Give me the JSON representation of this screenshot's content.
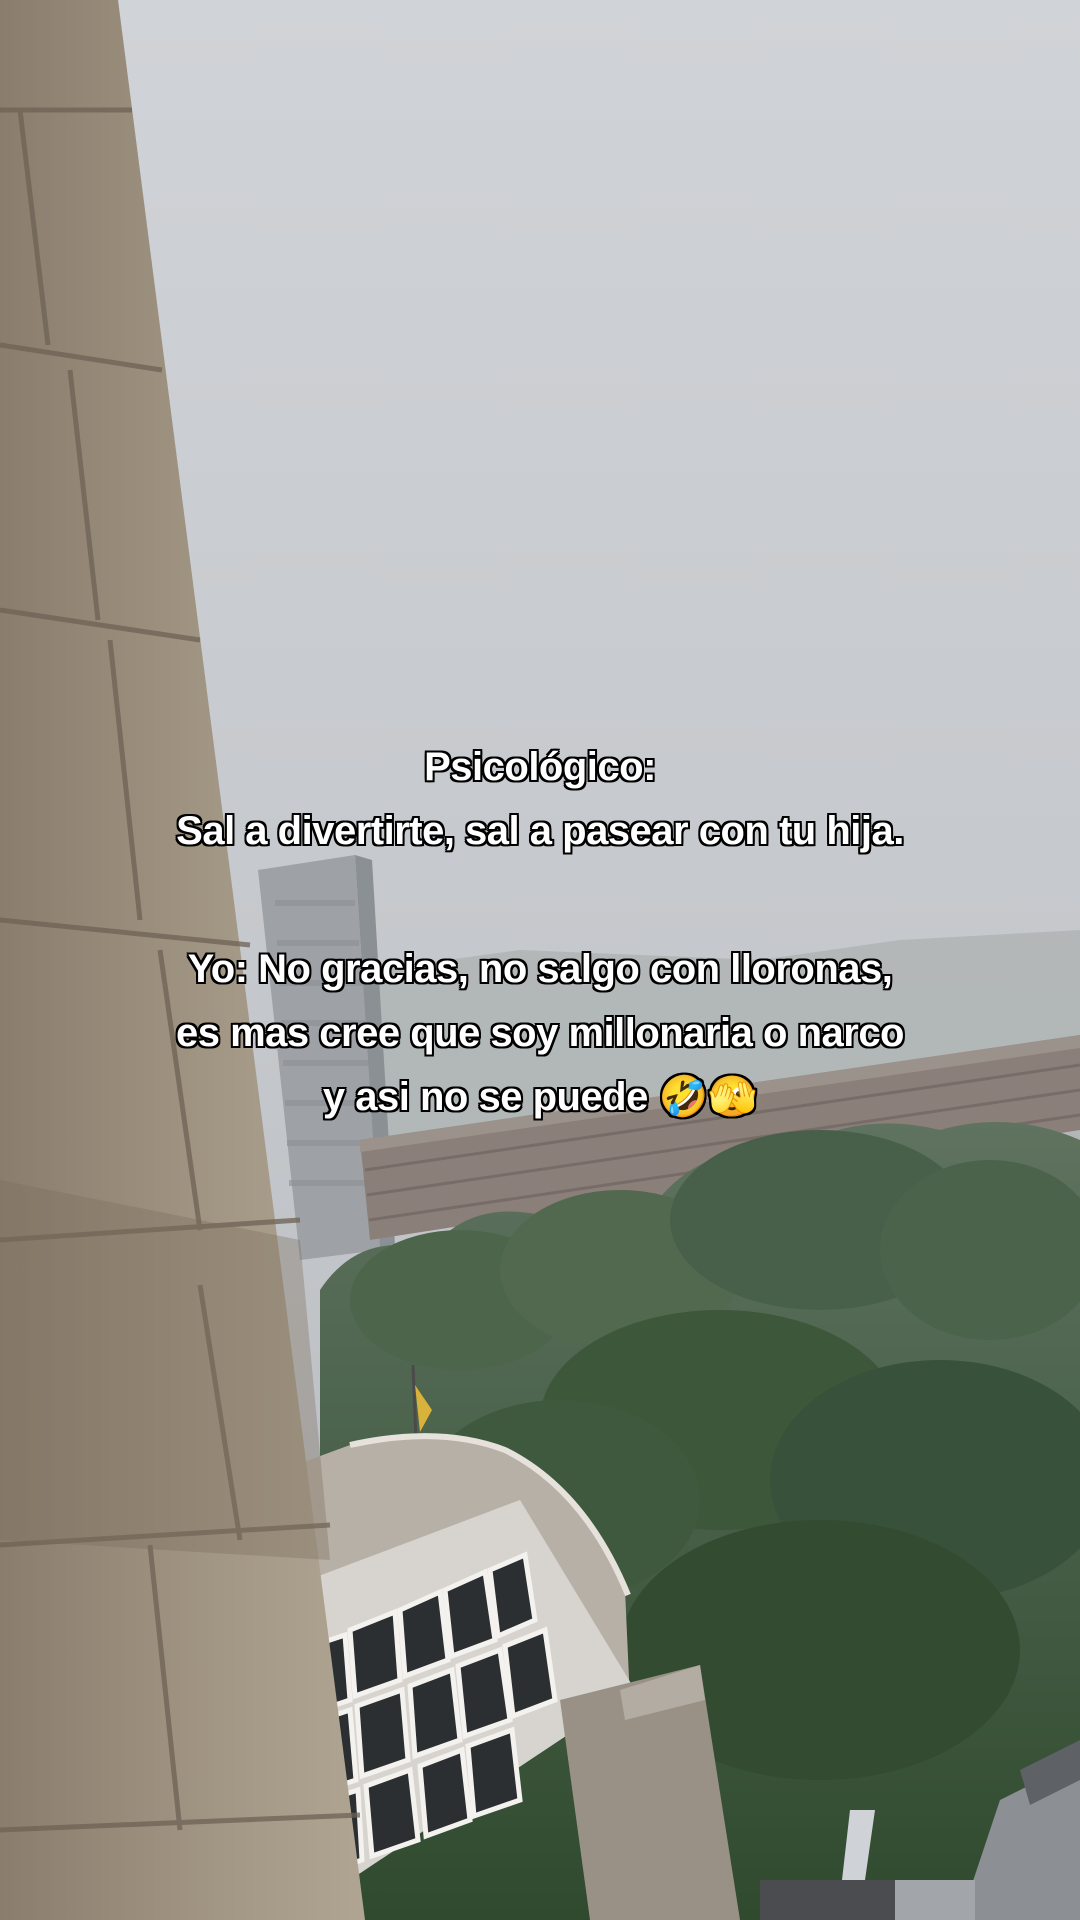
{
  "caption": {
    "line1": "Psicológico:",
    "line2": "Sal a divertirte, sal a pasear con tu hija.",
    "line3": "Yo: No gracias, no salgo con lloronas,",
    "line4": "es mas cree que soy millonaria o narco",
    "line5": "y asi no se puede 🤣🫣"
  },
  "colors": {
    "sky": "#c9ccd0",
    "foliage": "#3f5a3c",
    "concrete": "#9b8f80",
    "caption_text": "#ffffff",
    "caption_outline": "#000000"
  }
}
